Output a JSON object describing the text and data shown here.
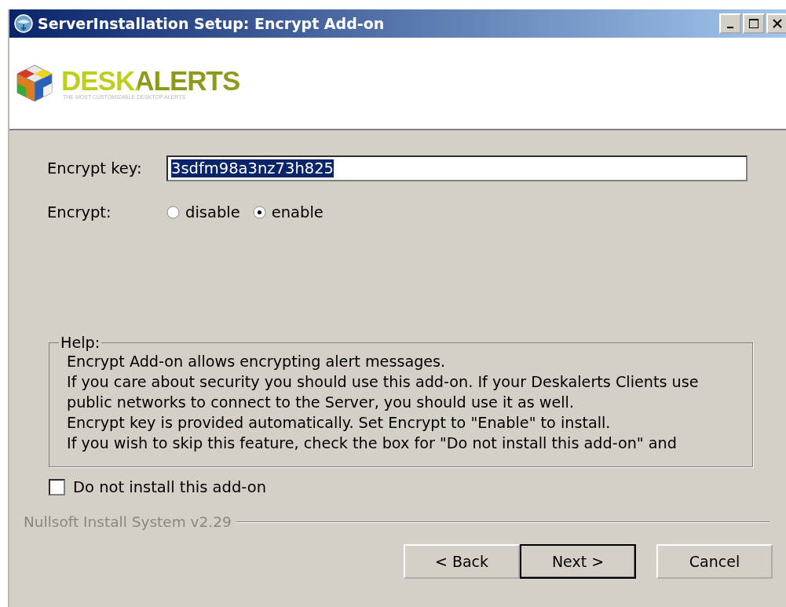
{
  "window": {
    "title": "ServerInstallation Setup: Encrypt Add-on"
  },
  "logo": {
    "name": "DESKALERTS",
    "tagline": "THE MOST CUSTOMIZABLE DESKTOP ALERTS"
  },
  "encrypt_key": {
    "label": "Encrypt key:",
    "value": "3sdfm98a3nz73h825",
    "selected_text": true
  },
  "encrypt": {
    "label": "Encrypt:",
    "options": [
      {
        "label": "disable",
        "selected": false
      },
      {
        "label": "enable",
        "selected": true
      }
    ]
  },
  "help": {
    "title": "Help:",
    "lines": [
      "Encrypt Add-on allows encrypting alert messages.",
      "If you care about security you should use this add-on. If your Deskalerts Clients use",
      "public networks to connect to the Server, you should use it as well.",
      "Encrypt key is provided automatically. Set Encrypt to \"Enable\" to install.",
      "If you wish to skip this feature, check the box for \"Do not install this add-on\" and"
    ]
  },
  "skip_checkbox": {
    "label": "Do not install this add-on",
    "checked": false
  },
  "branding": "Nullsoft Install System v2.29",
  "buttons": [
    {
      "label": "< Back",
      "default": false
    },
    {
      "label": "Next >",
      "default": true
    },
    {
      "label": "Cancel",
      "default": false
    }
  ]
}
